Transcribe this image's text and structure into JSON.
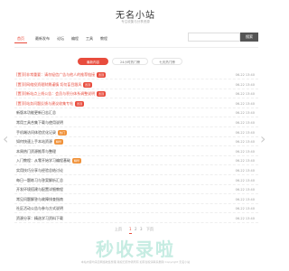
{
  "site": {
    "title": "无名小站",
    "subtitle": "专注收集与分享资源"
  },
  "nav": {
    "items": [
      "首页",
      "最新发布",
      "论坛",
      "编程",
      "工具",
      "教程"
    ],
    "search_placeholder": "",
    "search_label": "搜索"
  },
  "tabs": [
    "最新内容",
    "24小时热门榜",
    "七天热门榜"
  ],
  "posts": [
    {
      "prefix": "[置顶]",
      "title": "非常重要：请勿轻信广告与他人的推荐链接",
      "badge": "置顶",
      "date": "06-22 13:40",
      "red": true
    },
    {
      "prefix": "[置顶]",
      "title": "网络投资理财需谨慎 切勿盲目跟风",
      "badge": "置顶",
      "date": "06-22 13:40",
      "red": true
    },
    {
      "prefix": "[置顶]",
      "title": "新站点上线公告：会员与积分体系调整说明",
      "badge": "置顶",
      "date": "06-22 13:40",
      "red": true
    },
    {
      "prefix": "[置顶]",
      "title": "站务问题反馈与建议收集专帖",
      "badge": "置顶",
      "date": "06-22 13:40",
      "red": true
    },
    {
      "prefix": "",
      "title": "新版本功能更新日志汇总",
      "badge": "",
      "date": "06-22 13:40",
      "red": false
    },
    {
      "prefix": "",
      "title": "常用工具合集下载与使用说明",
      "badge": "",
      "date": "06-22 13:40",
      "red": false
    },
    {
      "prefix": "",
      "title": "手机端访问体验优化记录",
      "badge": "热门",
      "date": "06-22 13:40",
      "red": false
    },
    {
      "prefix": "",
      "title": "如何快速上手本站资源",
      "badge": "精华",
      "date": "06-22 13:40",
      "red": false
    },
    {
      "prefix": "",
      "title": "本周热门资源推荐与整理",
      "badge": "",
      "date": "06-22 13:40",
      "red": false
    },
    {
      "prefix": "",
      "title": "入门教程：从零开始学习编程基础",
      "badge": "精华",
      "date": "06-22 13:40",
      "red": false
    },
    {
      "prefix": "",
      "title": "实用技巧分享与经验总结讨论",
      "badge": "",
      "date": "06-22 13:40",
      "red": false
    },
    {
      "prefix": "",
      "title": "每日一题练习与答案解析汇总",
      "badge": "",
      "date": "06-22 13:40",
      "red": false
    },
    {
      "prefix": "",
      "title": "开发环境搭建与配置详细教程",
      "badge": "",
      "date": "06-22 13:40",
      "red": false
    },
    {
      "prefix": "",
      "title": "常见问题解答与故障排查指南",
      "badge": "",
      "date": "06-22 13:40",
      "red": false
    },
    {
      "prefix": "",
      "title": "社区活动公告与参与方式说明",
      "badge": "",
      "date": "06-22 13:40",
      "red": false
    },
    {
      "prefix": "",
      "title": "资源分享：精选学习资料下载",
      "badge": "",
      "date": "06-22 13:40",
      "red": false
    }
  ],
  "pagination": {
    "prev": "上页",
    "pages": [
      "1",
      "2",
      "3"
    ],
    "current": "1",
    "next": "下页"
  },
  "watermark": "秒收录啦",
  "footer": "本站内容均来自网络收集整理 版权归原作者所有 如有侵权请联系删除 Copyright 无名小站",
  "colors": {
    "accent": "#e84c3d",
    "badge_orange": "#f0923a",
    "watermark": "#c6ece2"
  },
  "icons": {
    "left_arrow": "chevron-left-icon",
    "right_arrow": "chevron-right-icon"
  }
}
